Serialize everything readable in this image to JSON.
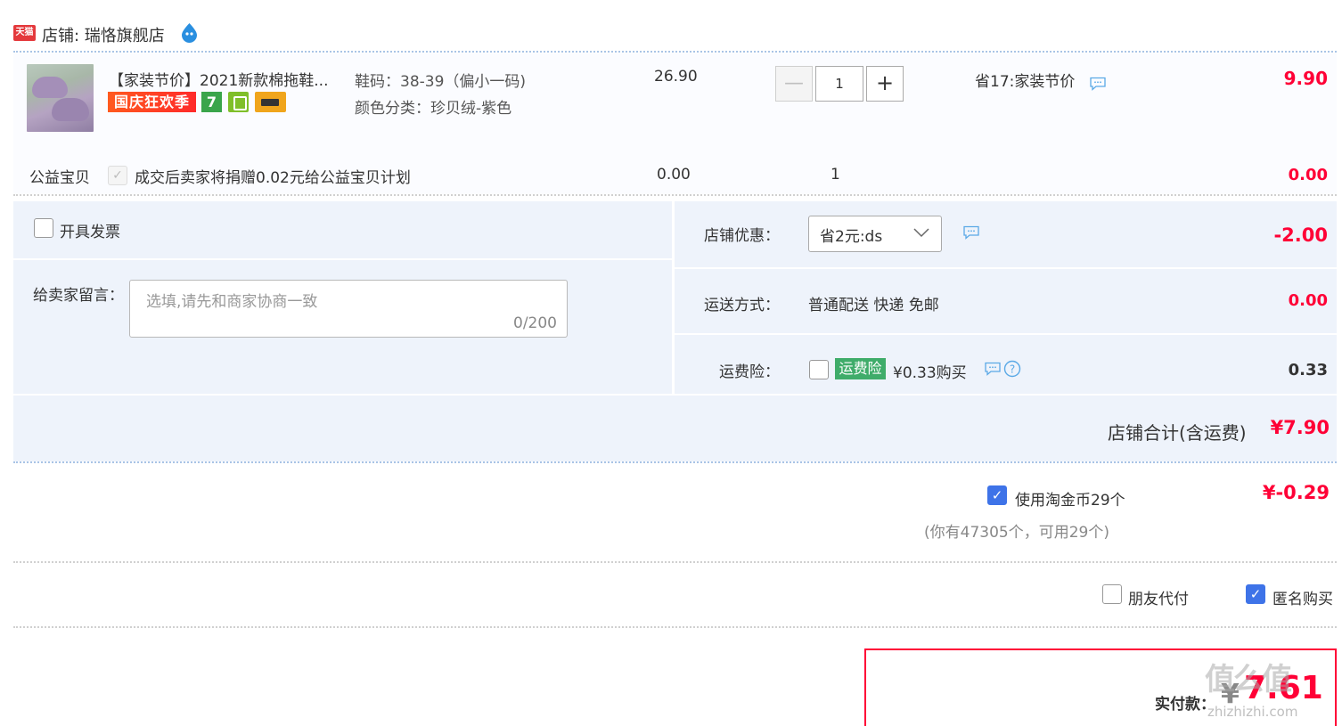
{
  "shop": {
    "badge": "天猫",
    "label": "店铺: 瑞恪旗舰店"
  },
  "item": {
    "title": "【家装节价】2021新款棉拖鞋...",
    "promo_tag": "国庆狂欢季",
    "seven_badge": "7",
    "sku_size": "鞋码：38-39（偏小一码)",
    "sku_color": "颜色分类：珍贝绒-紫色",
    "unit_price": "26.90",
    "quantity": "1",
    "qty_minus": "—",
    "qty_plus": "+",
    "discount_text": "省17:家装节价",
    "total": "9.90"
  },
  "charity": {
    "label": "公益宝贝",
    "text": "成交后卖家将捐赠0.02元给公益宝贝计划",
    "price": "0.00",
    "quantity": "1",
    "total": "0.00"
  },
  "invoice": {
    "label": "开具发票"
  },
  "message": {
    "label": "给卖家留言：",
    "placeholder": "选填,请先和商家协商一致",
    "count": "0/200"
  },
  "coupon": {
    "label": "店铺优惠：",
    "value": "省2元:ds",
    "amount": "-2.00"
  },
  "shipping": {
    "label": "运送方式：",
    "value": "普通配送 快递 免邮",
    "amount": "0.00"
  },
  "insurance": {
    "label": "运费险：",
    "tag": "运费险",
    "price": "¥0.33购买",
    "amount": "0.33"
  },
  "shop_total": {
    "label": "店铺合计(含运费)",
    "value": "¥7.90"
  },
  "coins": {
    "label": "使用淘金币29个",
    "amount": "¥-0.29",
    "note": "(你有47305个，可用29个)"
  },
  "friend_pay": {
    "label": "朋友代付"
  },
  "anonymous": {
    "label": "匿名购买"
  },
  "payment": {
    "label": "实付款：",
    "symbol": "¥",
    "value": "7.61"
  },
  "watermark": {
    "text": "值么值",
    "sub": "zhizhizhi.com"
  },
  "colors": {
    "price_red": "#ff0036",
    "panel_bg": "#eef3fb",
    "checkbox_blue": "#3e73e8",
    "insurance_green": "#3fac6a"
  },
  "icons": [
    "tmall-logo",
    "wangwang-icon",
    "chat-bubble-icon",
    "chevron-down-icon",
    "help-icon",
    "check-icon"
  ]
}
